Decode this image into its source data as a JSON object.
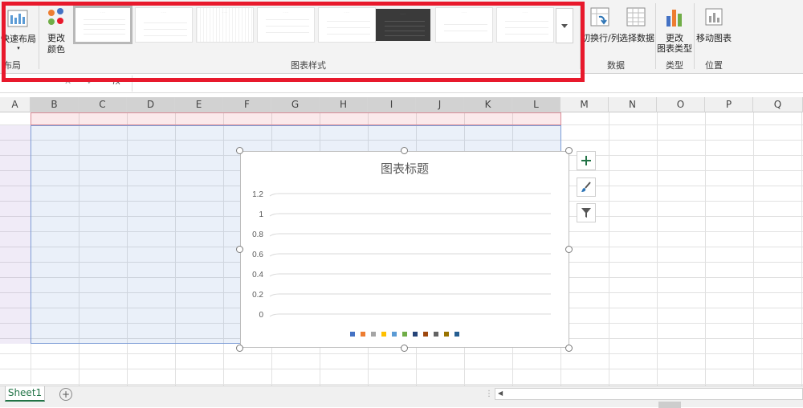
{
  "ribbon": {
    "quick_layout_label": "快速布局",
    "layout_group_label": "布局",
    "change_colors_line1": "更改",
    "change_colors_line2": "颜色",
    "chart_styles_group_label": "图表样式",
    "switch_row_col_label": "切换行/列",
    "select_data_label": "选择数据",
    "data_group_label": "数据",
    "change_type_line1": "更改",
    "change_type_line2": "图表类型",
    "type_group_label": "类型",
    "move_chart_label": "移动图表",
    "location_group_label": "位置"
  },
  "formula_bar": {
    "fx_label": "fx"
  },
  "columns": [
    "A",
    "B",
    "C",
    "D",
    "E",
    "F",
    "G",
    "H",
    "I",
    "J",
    "K",
    "L",
    "M",
    "N",
    "O",
    "P",
    "Q"
  ],
  "chart": {
    "title": "图表标题",
    "y_ticks": [
      "1.2",
      "1",
      "0.8",
      "0.6",
      "0.4",
      "0.2",
      "0"
    ],
    "legend_colors": [
      "#4472c4",
      "#ed7d31",
      "#a5a5a5",
      "#ffc000",
      "#5b9bd5",
      "#70ad47",
      "#264478",
      "#9e480e",
      "#636363",
      "#997300",
      "#255e91"
    ]
  },
  "chart_data": {
    "type": "line",
    "title": "图表标题",
    "ylim": [
      0,
      1.2
    ],
    "y_ticks": [
      0,
      0.2,
      0.4,
      0.6,
      0.8,
      1,
      1.2
    ],
    "grid": true,
    "legend_position": "bottom",
    "series": []
  },
  "sheet": {
    "tab_label": "Sheet1"
  },
  "colors": {
    "accent": "#217346",
    "highlight_red": "#e8192c"
  }
}
